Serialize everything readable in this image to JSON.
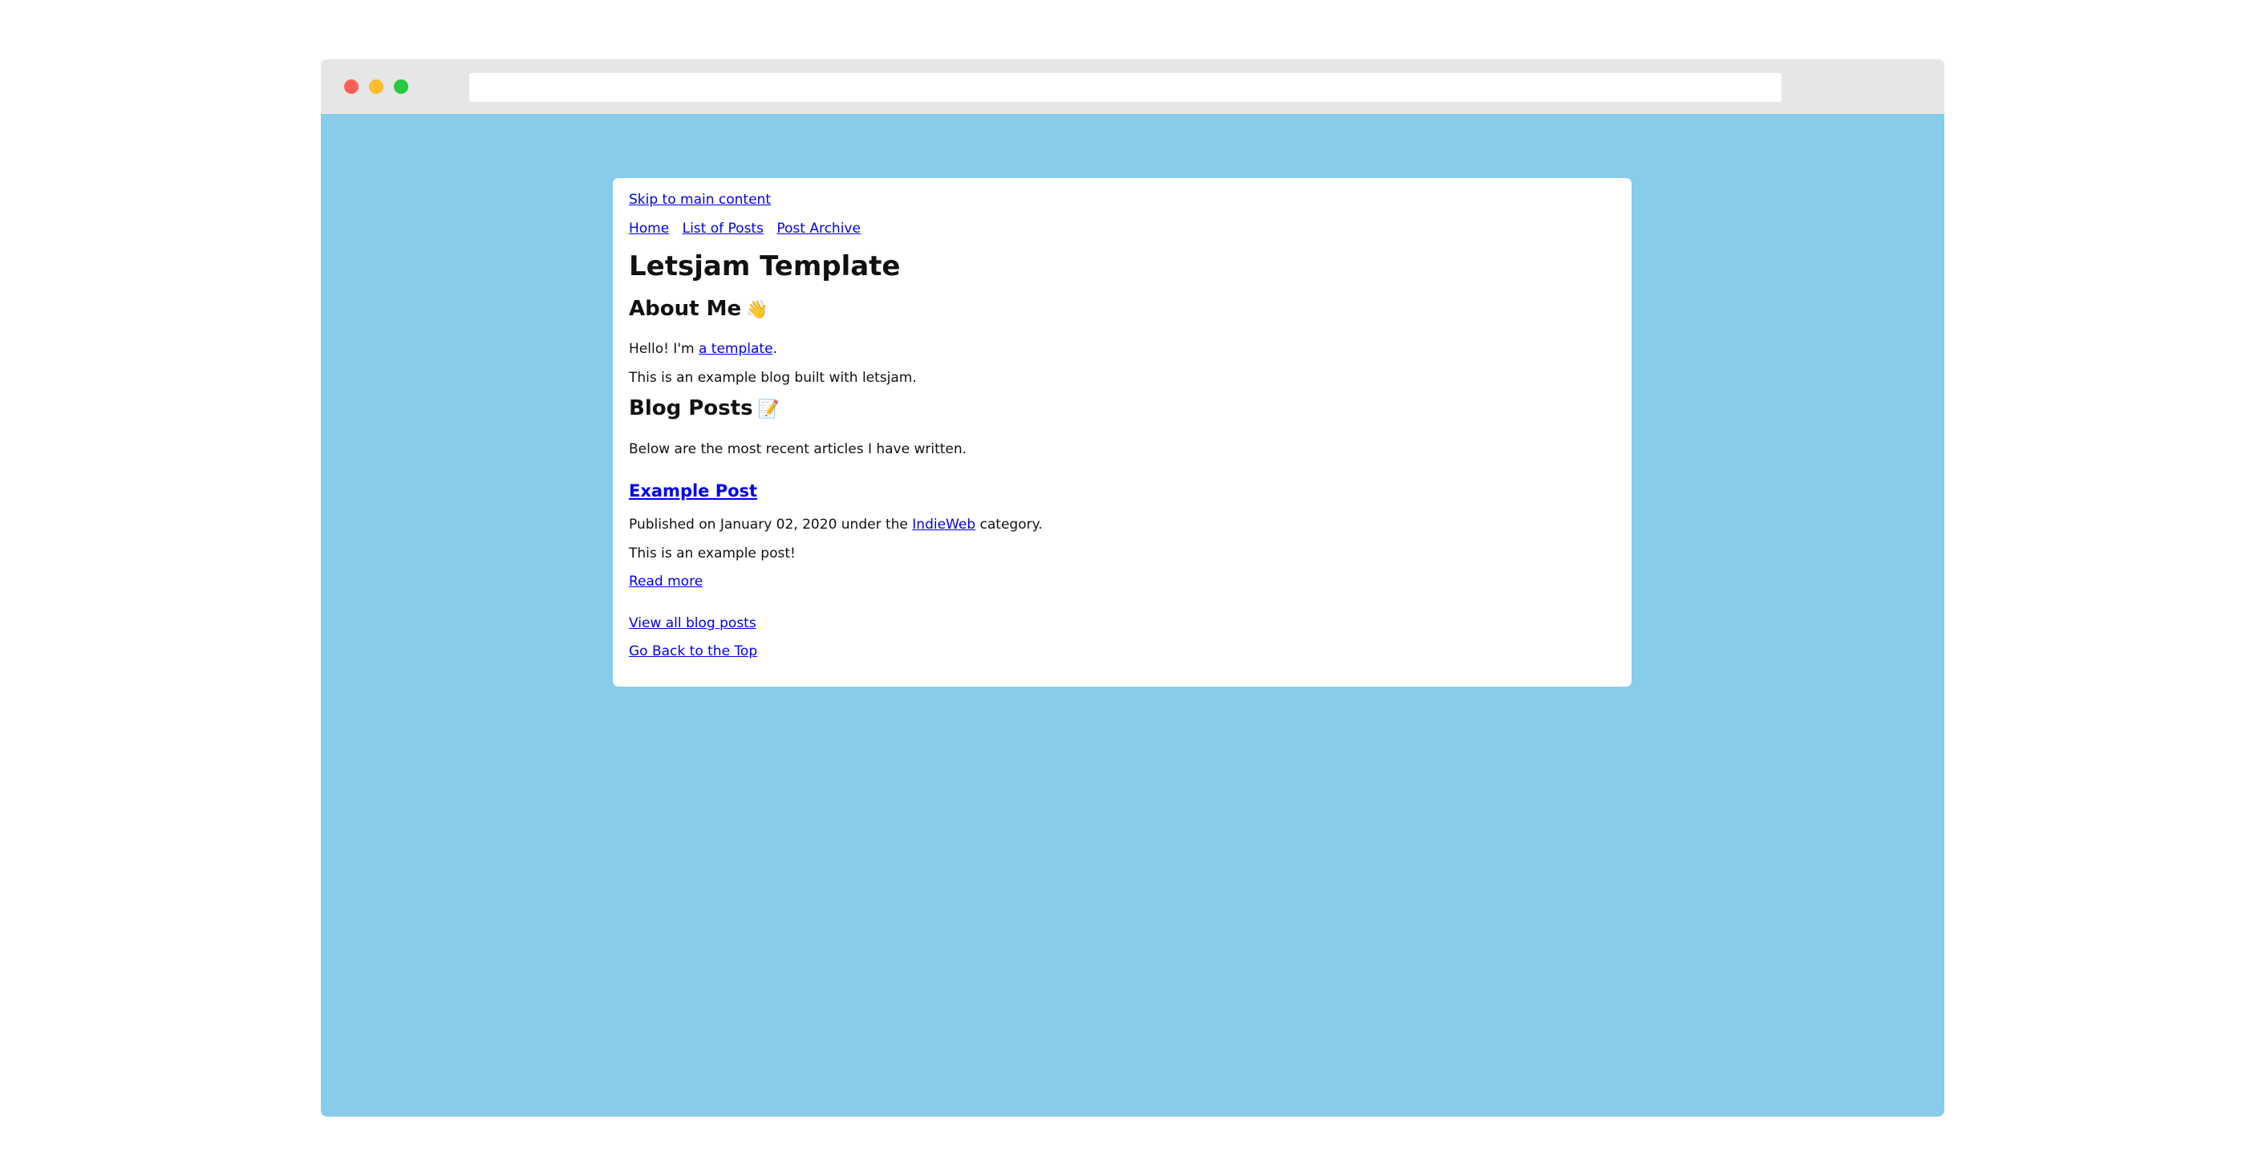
{
  "browser": {
    "url": ""
  },
  "page": {
    "skip_link": "Skip to main content",
    "nav": [
      "Home",
      "List of Posts",
      "Post Archive"
    ],
    "site_title": "Letsjam Template",
    "about": {
      "heading": "About Me",
      "heading_emoji": "👋",
      "intro_prefix": "Hello! I'm ",
      "intro_link": "a template",
      "intro_suffix": ".",
      "description": "This is an example blog built with letsjam."
    },
    "blog": {
      "heading": "Blog Posts",
      "heading_emoji": "📝",
      "description": "Below are the most recent articles I have written.",
      "posts": [
        {
          "title": "Example Post",
          "meta_prefix": "Published on January 02, 2020 under the ",
          "category": "IndieWeb",
          "meta_suffix": " category.",
          "excerpt": "This is an example post!",
          "read_more": "Read more"
        }
      ],
      "view_all": "View all blog posts"
    },
    "back_to_top": "Go Back to the Top"
  },
  "colors": {
    "page_background": "#87cde9",
    "card_background": "#ffffff",
    "link": "#0000ee",
    "titlebar": "#e6e6e6"
  }
}
